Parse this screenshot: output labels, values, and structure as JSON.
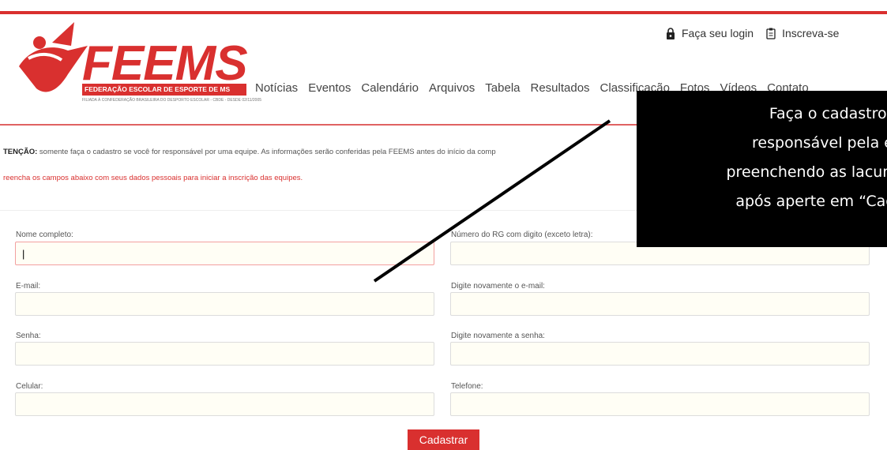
{
  "brand": {
    "name": "FEEMS",
    "subtitle": "FEDERAÇÃO ESCOLAR DE ESPORTE DE MS",
    "tagline": "FILIADA À CONFEDERAÇÃO BRASILEIRA DO DESPORTO ESCOLAR - CBDE - DESDE 02/11/2005",
    "accent_color": "#d9302f"
  },
  "top_links": {
    "login": {
      "label": "Faça seu login",
      "icon": "lock-icon"
    },
    "signup": {
      "label": "Inscreva-se",
      "icon": "clipboard-icon"
    }
  },
  "nav": [
    "Notícias",
    "Eventos",
    "Calendário",
    "Arquivos",
    "Tabela",
    "Resultados",
    "Classificação",
    "Fotos",
    "Vídeos",
    "Contato"
  ],
  "notice": {
    "prefix": "TENÇÃO:",
    "text": " somente faça o cadastro se você for responsável por uma equipe. As informações serão conferidas pela FEEMS antes do início da comp"
  },
  "instruction": "reencha os campos abaixo com seus dados pessoais para iniciar a inscrição das equipes.",
  "form": {
    "full_name_label": "Nome completo:",
    "full_name_value": "|",
    "rg_label": "Número do RG com digito (exceto letra):",
    "email_label": "E-mail:",
    "email_confirm_label": "Digite novamente o e-mail:",
    "password_label": "Senha:",
    "password_confirm_label": "Digite novamente a senha:",
    "mobile_label": "Celular:",
    "phone_label": "Telefone:",
    "submit_label": "Cadastrar"
  },
  "callout": {
    "lines": [
      "Faça o cadastro se f",
      "responsável pela eq",
      "preenchendo as lacuna",
      "após aperte em “Cada"
    ]
  }
}
